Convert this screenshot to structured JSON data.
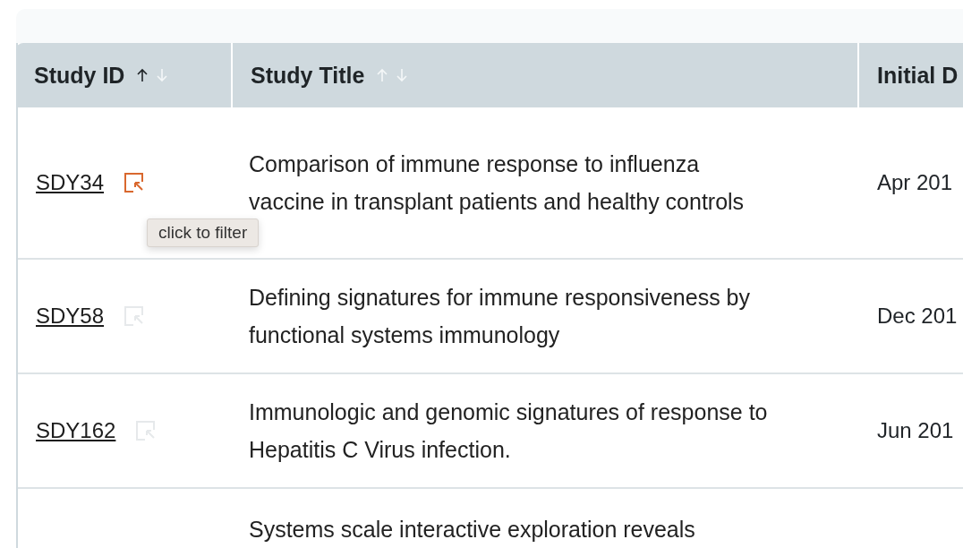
{
  "table": {
    "columns": [
      {
        "label": "Study ID",
        "sorted_ascending": true
      },
      {
        "label": "Study Title",
        "sorted_ascending": false
      },
      {
        "label": "Initial D"
      }
    ],
    "rows": [
      {
        "id": "SDY34",
        "filter_active": true,
        "title": "Comparison of immune response to influenza vaccine in transplant patients and healthy controls",
        "date": "Apr 201",
        "tooltip": "click to filter"
      },
      {
        "id": "SDY58",
        "filter_active": false,
        "title": "Defining signatures for immune responsiveness by functional systems immunology",
        "date": "Dec 201"
      },
      {
        "id": "SDY162",
        "filter_active": false,
        "title": "Immunologic and genomic signatures of response to Hepatitis C Virus infection.",
        "date": "Jun 201"
      },
      {
        "title": "Systems scale interactive exploration reveals"
      }
    ]
  }
}
